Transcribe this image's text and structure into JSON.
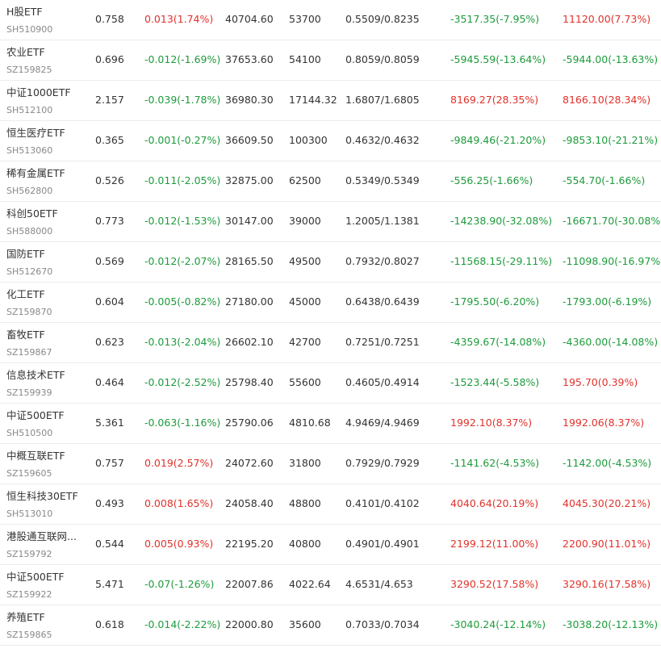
{
  "colors": {
    "up": "#e0322b",
    "down": "#1e9b3c",
    "text": "#333333",
    "code": "#888888",
    "divider": "#ececec"
  },
  "rows": [
    {
      "name": "H股ETF",
      "code": "SH510900",
      "price": "0.758",
      "change": "0.013(1.74%)",
      "change_dir": "up",
      "amount": "40704.60",
      "volume": "53700",
      "range": "0.5509/0.8235",
      "pnl1": "-3517.35(-7.95%)",
      "pnl1_dir": "down",
      "pnl2": "11120.00(7.73%)",
      "pnl2_dir": "up"
    },
    {
      "name": "农业ETF",
      "code": "SZ159825",
      "price": "0.696",
      "change": "-0.012(-1.69%)",
      "change_dir": "down",
      "amount": "37653.60",
      "volume": "54100",
      "range": "0.8059/0.8059",
      "pnl1": "-5945.59(-13.64%)",
      "pnl1_dir": "down",
      "pnl2": "-5944.00(-13.63%)",
      "pnl2_dir": "down"
    },
    {
      "name": "中证1000ETF",
      "code": "SH512100",
      "price": "2.157",
      "change": "-0.039(-1.78%)",
      "change_dir": "down",
      "amount": "36980.30",
      "volume": "17144.32",
      "range": "1.6807/1.6805",
      "pnl1": "8169.27(28.35%)",
      "pnl1_dir": "up",
      "pnl2": "8166.10(28.34%)",
      "pnl2_dir": "up"
    },
    {
      "name": "恒生医疗ETF",
      "code": "SH513060",
      "price": "0.365",
      "change": "-0.001(-0.27%)",
      "change_dir": "down",
      "amount": "36609.50",
      "volume": "100300",
      "range": "0.4632/0.4632",
      "pnl1": "-9849.46(-21.20%)",
      "pnl1_dir": "down",
      "pnl2": "-9853.10(-21.21%)",
      "pnl2_dir": "down"
    },
    {
      "name": "稀有金属ETF",
      "code": "SH562800",
      "price": "0.526",
      "change": "-0.011(-2.05%)",
      "change_dir": "down",
      "amount": "32875.00",
      "volume": "62500",
      "range": "0.5349/0.5349",
      "pnl1": "-556.25(-1.66%)",
      "pnl1_dir": "down",
      "pnl2": "-554.70(-1.66%)",
      "pnl2_dir": "down"
    },
    {
      "name": "科创50ETF",
      "code": "SH588000",
      "price": "0.773",
      "change": "-0.012(-1.53%)",
      "change_dir": "down",
      "amount": "30147.00",
      "volume": "39000",
      "range": "1.2005/1.1381",
      "pnl1": "-14238.90(-32.08%)",
      "pnl1_dir": "down",
      "pnl2": "-16671.70(-30.08%)",
      "pnl2_dir": "down"
    },
    {
      "name": "国防ETF",
      "code": "SH512670",
      "price": "0.569",
      "change": "-0.012(-2.07%)",
      "change_dir": "down",
      "amount": "28165.50",
      "volume": "49500",
      "range": "0.7932/0.8027",
      "pnl1": "-11568.15(-29.11%)",
      "pnl1_dir": "down",
      "pnl2": "-11098.90(-16.97%)",
      "pnl2_dir": "down"
    },
    {
      "name": "化工ETF",
      "code": "SZ159870",
      "price": "0.604",
      "change": "-0.005(-0.82%)",
      "change_dir": "down",
      "amount": "27180.00",
      "volume": "45000",
      "range": "0.6438/0.6439",
      "pnl1": "-1795.50(-6.20%)",
      "pnl1_dir": "down",
      "pnl2": "-1793.00(-6.19%)",
      "pnl2_dir": "down"
    },
    {
      "name": "畜牧ETF",
      "code": "SZ159867",
      "price": "0.623",
      "change": "-0.013(-2.04%)",
      "change_dir": "down",
      "amount": "26602.10",
      "volume": "42700",
      "range": "0.7251/0.7251",
      "pnl1": "-4359.67(-14.08%)",
      "pnl1_dir": "down",
      "pnl2": "-4360.00(-14.08%)",
      "pnl2_dir": "down"
    },
    {
      "name": "信息技术ETF",
      "code": "SZ159939",
      "price": "0.464",
      "change": "-0.012(-2.52%)",
      "change_dir": "down",
      "amount": "25798.40",
      "volume": "55600",
      "range": "0.4605/0.4914",
      "pnl1": "-1523.44(-5.58%)",
      "pnl1_dir": "down",
      "pnl2": "195.70(0.39%)",
      "pnl2_dir": "up"
    },
    {
      "name": "中证500ETF",
      "code": "SH510500",
      "price": "5.361",
      "change": "-0.063(-1.16%)",
      "change_dir": "down",
      "amount": "25790.06",
      "volume": "4810.68",
      "range": "4.9469/4.9469",
      "pnl1": "1992.10(8.37%)",
      "pnl1_dir": "up",
      "pnl2": "1992.06(8.37%)",
      "pnl2_dir": "up"
    },
    {
      "name": "中概互联ETF",
      "code": "SZ159605",
      "price": "0.757",
      "change": "0.019(2.57%)",
      "change_dir": "up",
      "amount": "24072.60",
      "volume": "31800",
      "range": "0.7929/0.7929",
      "pnl1": "-1141.62(-4.53%)",
      "pnl1_dir": "down",
      "pnl2": "-1142.00(-4.53%)",
      "pnl2_dir": "down"
    },
    {
      "name": "恒生科技30ETF",
      "code": "SH513010",
      "price": "0.493",
      "change": "0.008(1.65%)",
      "change_dir": "up",
      "amount": "24058.40",
      "volume": "48800",
      "range": "0.4101/0.4102",
      "pnl1": "4040.64(20.19%)",
      "pnl1_dir": "up",
      "pnl2": "4045.30(20.21%)",
      "pnl2_dir": "up"
    },
    {
      "name": "港股通互联网...",
      "code": "SZ159792",
      "price": "0.544",
      "change": "0.005(0.93%)",
      "change_dir": "up",
      "amount": "22195.20",
      "volume": "40800",
      "range": "0.4901/0.4901",
      "pnl1": "2199.12(11.00%)",
      "pnl1_dir": "up",
      "pnl2": "2200.90(11.01%)",
      "pnl2_dir": "up"
    },
    {
      "name": "中证500ETF",
      "code": "SZ159922",
      "price": "5.471",
      "change": "-0.07(-1.26%)",
      "change_dir": "down",
      "amount": "22007.86",
      "volume": "4022.64",
      "range": "4.6531/4.653",
      "pnl1": "3290.52(17.58%)",
      "pnl1_dir": "up",
      "pnl2": "3290.16(17.58%)",
      "pnl2_dir": "up"
    },
    {
      "name": "养殖ETF",
      "code": "SZ159865",
      "price": "0.618",
      "change": "-0.014(-2.22%)",
      "change_dir": "down",
      "amount": "22000.80",
      "volume": "35600",
      "range": "0.7033/0.7034",
      "pnl1": "-3040.24(-12.14%)",
      "pnl1_dir": "down",
      "pnl2": "-3038.20(-12.13%)",
      "pnl2_dir": "down"
    }
  ]
}
